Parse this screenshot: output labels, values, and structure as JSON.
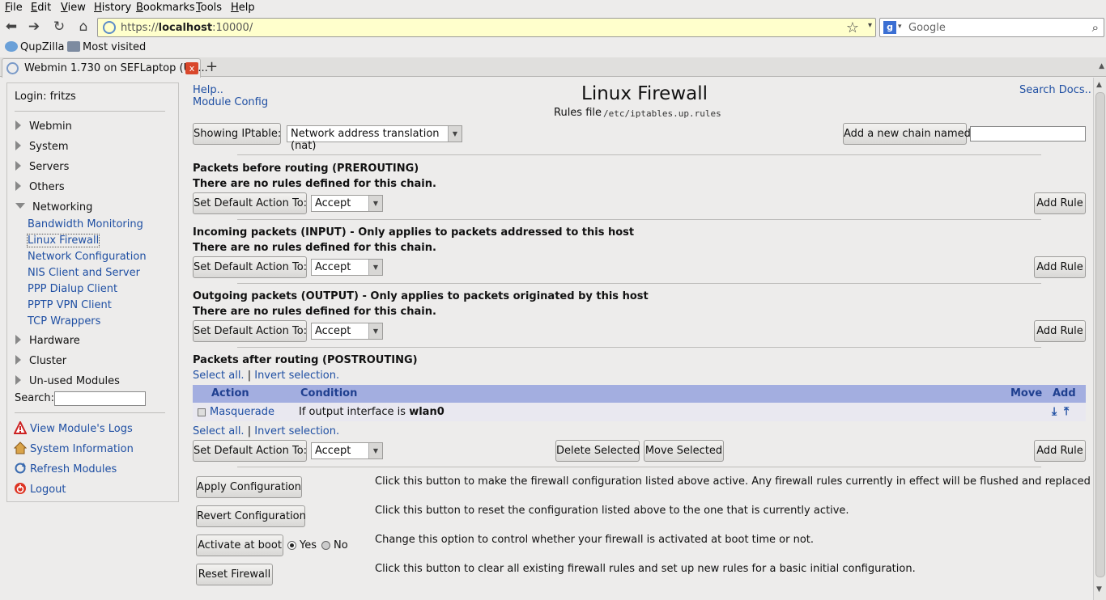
{
  "menu": [
    "File",
    "Edit",
    "View",
    "History",
    "Bookmarks",
    "Tools",
    "Help"
  ],
  "url": {
    "scheme": "https://",
    "host": "localhost",
    "rest": ":10000/"
  },
  "search": {
    "engine": "Google",
    "engine_icon": "g-icon"
  },
  "bookmarks": {
    "qupzilla": "QupZilla",
    "most_visited": "Most visited"
  },
  "tab": {
    "title": "Webmin 1.730 on SEFLaptop (Ub...",
    "close": "x",
    "new": "+"
  },
  "sidebar": {
    "login": "Login: fritzs",
    "categories_top": [
      "Webmin",
      "System",
      "Servers",
      "Others"
    ],
    "open_category": "Networking",
    "modules": [
      "Bandwidth Monitoring",
      "Linux Firewall",
      "Network Configuration",
      "NIS Client and Server",
      "PPP Dialup Client",
      "PPTP VPN Client",
      "TCP Wrappers"
    ],
    "categories_bottom": [
      "Hardware",
      "Cluster",
      "Un-used Modules"
    ],
    "search_label": "Search:",
    "links": [
      "View Module's Logs",
      "System Information",
      "Refresh Modules",
      "Logout"
    ]
  },
  "header": {
    "help": "Help..",
    "module_config": "Module Config",
    "title": "Linux Firewall",
    "rules_label": "Rules file",
    "rules_path": "/etc/iptables.up.rules",
    "search_docs": "Search Docs.."
  },
  "table_select": {
    "button": "Showing IPtable:",
    "value": "Network address translation (nat)"
  },
  "add_chain": {
    "button": "Add a new chain named:",
    "value": ""
  },
  "chains": [
    {
      "title": "Packets before routing (PREROUTING)",
      "note": "There are no rules defined for this chain."
    },
    {
      "title": "Incoming packets (INPUT) - Only applies to packets addressed to this host",
      "note": "There are no rules defined for this chain."
    },
    {
      "title": "Outgoing packets (OUTPUT) - Only applies to packets originated by this host",
      "note": "There are no rules defined for this chain."
    },
    {
      "title": "Packets after routing (POSTROUTING)"
    }
  ],
  "default_action": {
    "button": "Set Default Action To:",
    "value": "Accept"
  },
  "add_rule": "Add Rule",
  "select_all": "Select all.",
  "separator": "|",
  "invert_selection": "Invert selection.",
  "rules_table": {
    "headers": {
      "action": "Action",
      "condition": "Condition",
      "move": "Move",
      "add": "Add"
    },
    "rows": [
      {
        "action": "Masquerade",
        "condition_prefix": "If output interface is",
        "condition_value": "wlan0"
      }
    ]
  },
  "delete_selected": "Delete Selected",
  "move_selected": "Move Selected",
  "bottom": {
    "apply": {
      "button": "Apply Configuration",
      "desc": "Click this button to make the firewall configuration listed above active. Any firewall rules currently in effect will be flushed and replaced"
    },
    "revert": {
      "button": "Revert Configuration",
      "desc": "Click this button to reset the configuration listed above to the one that is currently active."
    },
    "boot": {
      "button": "Activate at boot",
      "yes": "Yes",
      "no": "No",
      "selected": "Yes",
      "desc": "Change this option to control whether your firewall is activated at boot time or not."
    },
    "reset": {
      "button": "Reset Firewall",
      "desc": "Click this button to clear all existing firewall rules and set up new rules for a basic initial configuration."
    }
  },
  "colors": {
    "table_header": "#a3aee0",
    "link": "#1f4fa3",
    "url_bg": "#ffffcc"
  }
}
